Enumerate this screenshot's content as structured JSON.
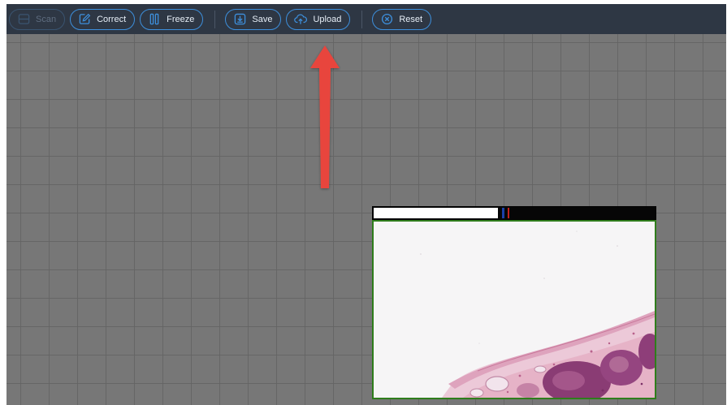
{
  "toolbar": {
    "buttons": [
      {
        "id": "scan",
        "label": "Scan",
        "icon": "scan-icon",
        "enabled": false
      },
      {
        "id": "correct",
        "label": "Correct",
        "icon": "edit-icon",
        "enabled": true
      },
      {
        "id": "freeze",
        "label": "Freeze",
        "icon": "pause-icon",
        "enabled": true
      },
      {
        "id": "save",
        "label": "Save",
        "icon": "save-icon",
        "enabled": true
      },
      {
        "id": "upload",
        "label": "Upload",
        "icon": "cloud-upload-icon",
        "enabled": true
      },
      {
        "id": "reset",
        "label": "Reset",
        "icon": "reset-icon",
        "enabled": true
      }
    ]
  },
  "annotation": {
    "icon": "red-arrow-icon",
    "color": "#e8453c",
    "points_to": "Upload"
  },
  "scan_progress": {
    "filled_fraction": 0.44,
    "blue_marker_fraction": 0.453,
    "red_marker_fraction": 0.475
  },
  "slide_preview": {
    "content": "histology-tissue-image",
    "border_color": "#2f7d1c"
  },
  "colors": {
    "toolbar_bg": "#2e3744",
    "button_border": "#3d8fdc",
    "canvas_bg": "#777777",
    "grid_line": "#646464"
  }
}
